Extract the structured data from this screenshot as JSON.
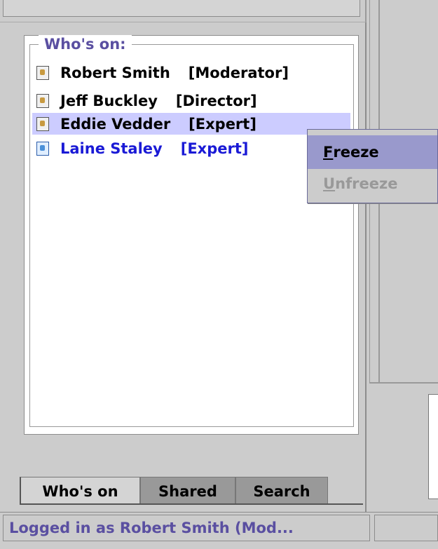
{
  "panel": {
    "group_title": "Who's on:",
    "users": [
      {
        "name": "Robert Smith",
        "role": "[Moderator]",
        "selected": false,
        "color": "#000000"
      },
      {
        "name": "Jeff Buckley",
        "role": "[Director]",
        "selected": false,
        "color": "#000000"
      },
      {
        "name": "Eddie Vedder",
        "role": "[Expert]",
        "selected": true,
        "color": "#000000"
      },
      {
        "name": "Laine Staley",
        "role": "[Expert]",
        "selected": false,
        "color": "#1a1ad6"
      }
    ]
  },
  "tabs": [
    {
      "label": "Who's on",
      "active": true
    },
    {
      "label": "Shared",
      "active": false
    },
    {
      "label": "Search",
      "active": false
    }
  ],
  "context_menu": {
    "freeze_mnemonic": "F",
    "freeze_rest": "reeze",
    "unfreeze_mnemonic": "U",
    "unfreeze_rest": "nfreeze"
  },
  "status": {
    "text": "Logged in as Robert Smith (Mod..."
  },
  "colors": {
    "accent_text": "#5a4fa1",
    "selection": "#ccccff",
    "menu_highlight": "#9999cc",
    "link_user": "#1a1ad6",
    "disabled": "#999999"
  }
}
